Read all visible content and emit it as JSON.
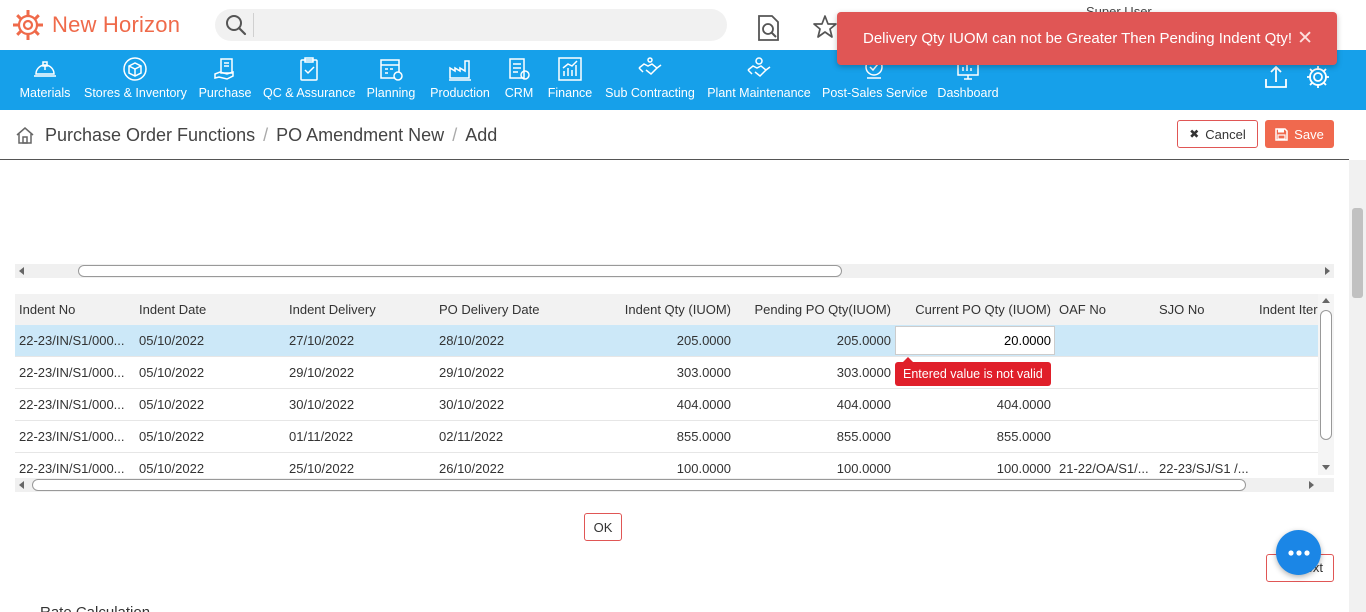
{
  "brand": {
    "name": "New Horizon"
  },
  "search": {
    "placeholder": ""
  },
  "user": {
    "name": "Super User"
  },
  "toast": {
    "message": "Delivery Qty IUOM can not be Greater Then Pending Indent Qty!",
    "close": "✕",
    "color": "#e05655"
  },
  "nav": {
    "items": [
      {
        "label": "Materials",
        "icon": "helmet-icon"
      },
      {
        "label": "Stores & Inventory",
        "icon": "boxes-icon"
      },
      {
        "label": "Purchase",
        "icon": "purchase-icon"
      },
      {
        "label": "QC & Assurance",
        "icon": "clipboard-icon"
      },
      {
        "label": "Planning",
        "icon": "calendar-icon"
      },
      {
        "label": "Production",
        "icon": "factory-icon"
      },
      {
        "label": "CRM",
        "icon": "crm-icon"
      },
      {
        "label": "Finance",
        "icon": "bar-chart-icon"
      },
      {
        "label": "Sub Contracting",
        "icon": "handshake-icon"
      },
      {
        "label": "Plant Maintenance",
        "icon": "handshake-icon"
      },
      {
        "label": "Post-Sales Service",
        "icon": "service-icon"
      },
      {
        "label": "Dashboard",
        "icon": "dashboard-icon"
      }
    ],
    "color": "#16a0ea"
  },
  "breadcrumb": {
    "items": [
      "Purchase Order Functions",
      "PO Amendment New",
      "Add"
    ],
    "separator": "/"
  },
  "actions": {
    "cancel": "Cancel",
    "save": "Save",
    "ok": "OK",
    "next": "Next"
  },
  "grid": {
    "columns": [
      "Indent No",
      "Indent Date",
      "Indent Delivery",
      "PO Delivery Date",
      "Indent Qty (IUOM)",
      "Pending PO Qty(IUOM)",
      "Current PO Qty (IUOM)",
      "OAF No",
      "SJO No",
      "Indent Iter"
    ],
    "rows": [
      {
        "indent_no": "22-23/IN/S1/000...",
        "indent_date": "05/10/2022",
        "indent_delivery": "27/10/2022",
        "po_delivery": "28/10/2022",
        "indent_qty": "205.0000",
        "pending_qty": "205.0000",
        "current_qty": "20.0000",
        "oaf_no": "",
        "sjo_no": ""
      },
      {
        "indent_no": "22-23/IN/S1/000...",
        "indent_date": "05/10/2022",
        "indent_delivery": "29/10/2022",
        "po_delivery": "29/10/2022",
        "indent_qty": "303.0000",
        "pending_qty": "303.0000",
        "current_qty": "",
        "oaf_no": "",
        "sjo_no": ""
      },
      {
        "indent_no": "22-23/IN/S1/000...",
        "indent_date": "05/10/2022",
        "indent_delivery": "30/10/2022",
        "po_delivery": "30/10/2022",
        "indent_qty": "404.0000",
        "pending_qty": "404.0000",
        "current_qty": "404.0000",
        "oaf_no": "",
        "sjo_no": ""
      },
      {
        "indent_no": "22-23/IN/S1/000...",
        "indent_date": "05/10/2022",
        "indent_delivery": "01/11/2022",
        "po_delivery": "02/11/2022",
        "indent_qty": "855.0000",
        "pending_qty": "855.0000",
        "current_qty": "855.0000",
        "oaf_no": "",
        "sjo_no": ""
      },
      {
        "indent_no": "22-23/IN/S1/000...",
        "indent_date": "05/10/2022",
        "indent_delivery": "25/10/2022",
        "po_delivery": "26/10/2022",
        "indent_qty": "100.0000",
        "pending_qty": "100.0000",
        "current_qty": "100.0000",
        "oaf_no": "21-22/OA/S1/...",
        "sjo_no": "22-23/SJ/S1 /..."
      }
    ],
    "validation_message": "Entered value is not valid"
  },
  "section": {
    "label": "Rate Calculation"
  }
}
